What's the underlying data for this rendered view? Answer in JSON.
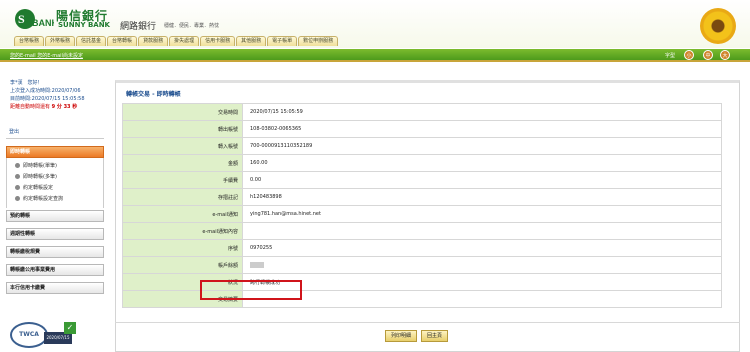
{
  "header": {
    "logo_cn": "陽信銀行",
    "logo_en": "SUNNY BANK",
    "bank_name": "網路銀行",
    "slogan": "穩健．便民．專業．熱忱",
    "tabs": [
      "台幣帳務",
      "外幣帳務",
      "信託基金",
      "台幣轉帳",
      "貸款服務",
      "掛失處理",
      "信用卡服務",
      "其他服務",
      "電子帳單",
      "數位申辦服務"
    ]
  },
  "greenbar": {
    "mail_text": "您的E-mail 您的E-mail尚未設定",
    "fontsize_label": "字型",
    "sizes": [
      "小",
      "中",
      "大"
    ]
  },
  "welcome": {
    "name": "李*漢　您好！",
    "last_login": "上次登入成功時間:2020/07/06",
    "now": "目前時間:2020/07/15 15:05:58",
    "auto_logout_prefix": "距離自動時間還有",
    "auto_logout_value": "9 分 33 秒"
  },
  "sidebar": {
    "logout": "登出",
    "active": "即時轉帳",
    "sub_items": [
      "即時轉帳(單筆)",
      "即時轉帳(多筆)",
      "約定轉帳設定",
      "約定轉帳設定查詢"
    ],
    "items": [
      "預約轉帳",
      "週期性轉帳",
      "轉帳繳稅規費",
      "轉帳繳公用事業費用",
      "本行信用卡繳費"
    ],
    "twca_label": "TWCA",
    "twca_date": "2020/07/15"
  },
  "main": {
    "title": "轉帳交易 - 即時轉帳",
    "rows": [
      {
        "k": "交易時間",
        "v": "2020/07/15 15:05:59"
      },
      {
        "k": "轉出帳號",
        "v": "108-03802-0065365"
      },
      {
        "k": "轉入帳號",
        "v": "700-0000913110352189"
      },
      {
        "k": "金額",
        "v": "160.00"
      },
      {
        "k": "手續費",
        "v": "0.00"
      },
      {
        "k": "存摺註記",
        "v": "h120483898"
      },
      {
        "k": "e-mail通知",
        "v": "ying781.han@msa.hinet.net"
      },
      {
        "k": "e-mail通知內容",
        "v": ""
      },
      {
        "k": "序號",
        "v": "0970255"
      },
      {
        "k": "帳戶餘額",
        "v": ""
      },
      {
        "k": "狀況",
        "v": "跨行轉帳成功"
      },
      {
        "k": "交易摘要",
        "v": ""
      }
    ],
    "buttons": [
      "列印明細",
      "回主頁"
    ]
  },
  "colors": {
    "brand_green": "#4d9a1c",
    "label_bg": "#dff0c9",
    "highlight": "#d0141b",
    "active_orange": "#ec7a26"
  }
}
